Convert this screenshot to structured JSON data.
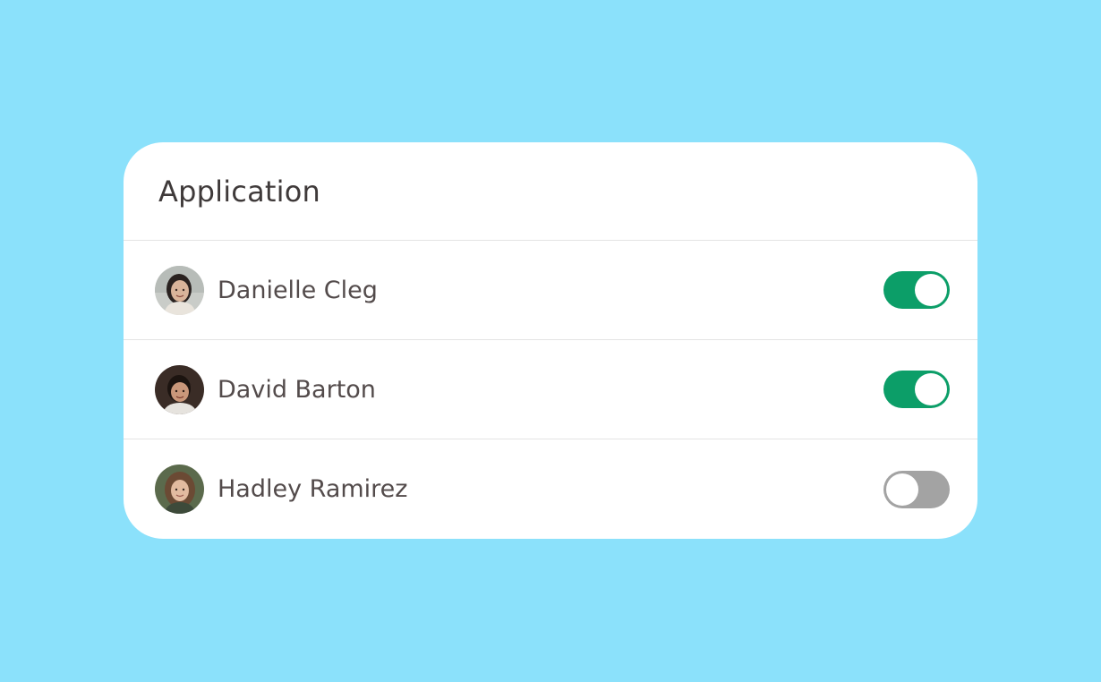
{
  "card": {
    "title": "Application"
  },
  "users": [
    {
      "name": "Danielle Cleg",
      "enabled": true,
      "avatar": "avatar-danielle"
    },
    {
      "name": "David Barton",
      "enabled": true,
      "avatar": "avatar-david"
    },
    {
      "name": "Hadley Ramirez",
      "enabled": false,
      "avatar": "avatar-hadley"
    }
  ],
  "colors": {
    "background": "#8be1fb",
    "card": "#ffffff",
    "toggle_on": "#0c9e68",
    "toggle_off": "#a3a3a3",
    "text": "#534b4b"
  }
}
